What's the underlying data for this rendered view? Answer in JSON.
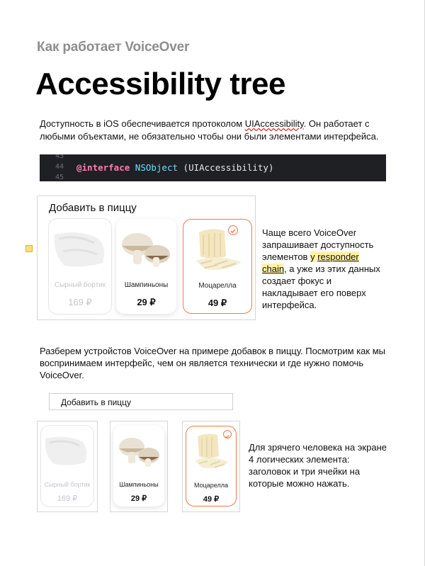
{
  "header": {
    "subtitle": "Как работает VoiceOver",
    "title": "Accessibility tree"
  },
  "intro": {
    "before": "Доступность в iOS обеспечивается протоколом ",
    "protocol": "UIAccessibility",
    "after": ". Он работает с любыми объектами, не обязательно чтобы они были элементами интерфейса."
  },
  "code": {
    "line_numbers": [
      "43",
      "44",
      "45"
    ],
    "keyword": "@interface",
    "class_name": "NSObject",
    "category": "(UIAccessibility)"
  },
  "example1": {
    "title": "Добавить в пиццу",
    "cards": [
      {
        "name": "Сырный бортик",
        "price": "169 ₽",
        "state": "disabled",
        "icon": "cheese-crust-image"
      },
      {
        "name": "Шампиньоны",
        "price": "29 ₽",
        "state": "normal",
        "icon": "mushrooms-image"
      },
      {
        "name": "Моцарелла",
        "price": "49 ₽",
        "state": "selected",
        "icon": "mozzarella-image"
      }
    ],
    "note_before": "Чаще всего VoiceOver запрашивает доступность элементов ",
    "note_highlight_plain": "у ",
    "note_highlight_link": "responder chain",
    "note_after": ", а уже из этих данных создает фокус и накладывает его поверх интерфейса."
  },
  "paragraph2": "Разберем устройстов VoiceOver на примере добавок в пиццу. Посмотрим как мы воспринимаем интерфейс, чем он является технически и где нужно помочь VoiceOver.",
  "example2": {
    "title": "Добавить в пиццу",
    "cards": [
      {
        "name": "Сырный бортик",
        "price": "169 ₽",
        "state": "disabled"
      },
      {
        "name": "Шампиньоны",
        "price": "29 ₽",
        "state": "normal"
      },
      {
        "name": "Моцарелла",
        "price": "49 ₽",
        "state": "selected"
      }
    ],
    "note": "Для зрячего человека на экране 4 логических элемента: заголовок и три ячейки на которые можно нажать."
  },
  "colors": {
    "accent": "#f07b4a",
    "highlight": "#fff2a8",
    "code_bg": "#1f2024"
  }
}
